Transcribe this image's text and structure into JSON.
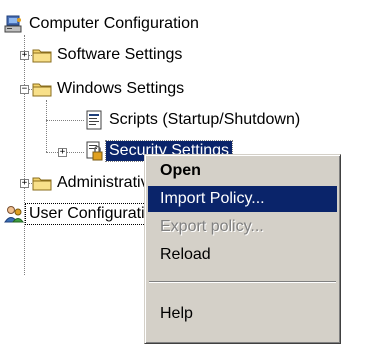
{
  "tree": {
    "computer_config": "Computer Configuration",
    "software_settings": "Software Settings",
    "windows_settings": "Windows Settings",
    "scripts": "Scripts (Startup/Shutdown)",
    "security_settings": "Security Settings",
    "admin_templates": "Administrative Templates",
    "user_config": "User Configuration"
  },
  "context_menu": {
    "open_label": "Open",
    "import_policy_label": "Import Policy...",
    "export_policy_label": "Export policy...",
    "reload_label": "Reload",
    "help_label": "Help"
  },
  "colors": {
    "selection": "#0a246a",
    "menu_background": "#d4d0c8",
    "folder_yellow": "#f4d46c"
  },
  "icons": {
    "computer_config": "computer-icon",
    "folder": "folder-icon",
    "scripts": "script-icon",
    "security_settings": "shield-lock-icon",
    "user_config": "user-icon"
  }
}
